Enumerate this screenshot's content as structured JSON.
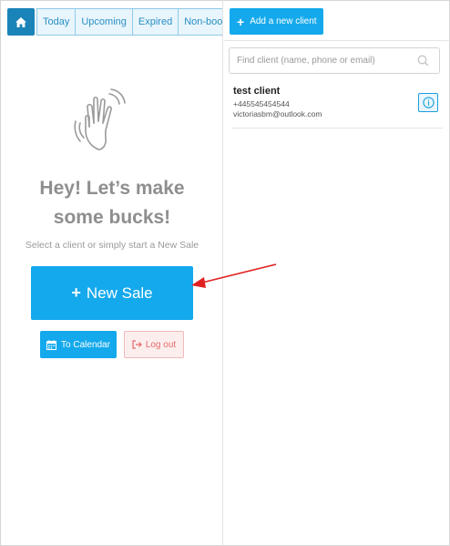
{
  "left_panel": {
    "tabs": [
      {
        "label": "Today"
      },
      {
        "label": "Upcoming"
      },
      {
        "label": "Expired"
      },
      {
        "label": "Non-boo"
      }
    ],
    "hero_line1": "Hey! Let’s make",
    "hero_line2": "some bucks!",
    "subtitle": "Select a client or simply start a New Sale",
    "new_sale_label": "New Sale",
    "calendar_label": "To Calendar",
    "logout_label": "Log out"
  },
  "right_panel": {
    "add_client_label": "Add a new client",
    "search_placeholder": "Find client (name, phone or email)",
    "clients": [
      {
        "name": "test client",
        "phone": "+445545454544",
        "email": "victoriasbm@outlook.com"
      }
    ]
  },
  "colors": {
    "primary": "#14a9ec",
    "home": "#1a83b8",
    "danger": "#e56a6a",
    "annotation_arrow": "#e02020"
  },
  "icons": [
    "home-icon",
    "waving-hand-icon",
    "calendar-icon",
    "logout-icon",
    "search-icon",
    "info-icon",
    "plus-icon"
  ]
}
